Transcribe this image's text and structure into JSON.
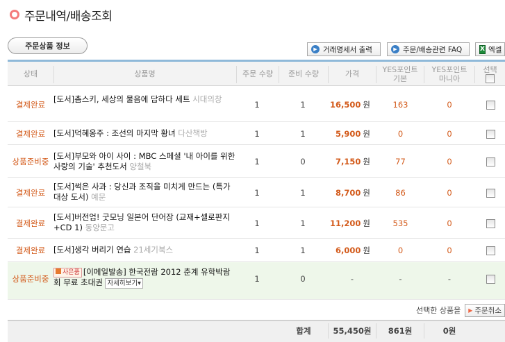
{
  "page": {
    "title": "주문내역/배송조회"
  },
  "tabs": {
    "order_info": "주문상품 정보"
  },
  "toolbar": {
    "receipt": "거래명세서 출력",
    "faq": "주문/배송관련 FAQ",
    "excel": "엑셀",
    "excel_icon": "X"
  },
  "columns": {
    "status": "상태",
    "name": "상품명",
    "qty": "주문 수량",
    "ready": "준비 수량",
    "price": "가격",
    "point_basic_1": "YES포인트",
    "point_basic_2": "기본",
    "point_mania_1": "YES포인트",
    "point_mania_2": "마니아",
    "select": "선택"
  },
  "rows": [
    {
      "status": "결제완료",
      "title": "[도서]촘스키, 세상의 물음에 답하다 세트",
      "publisher": "시대의창",
      "qty": "1",
      "ready": "1",
      "price": "16,500",
      "won": "원",
      "basic": "163",
      "mania": "0"
    },
    {
      "status": "결제완료",
      "title": "[도서]덕혜옹주 : 조선의 마지막 황녀",
      "publisher": "다산책방",
      "qty": "1",
      "ready": "1",
      "price": "5,900",
      "won": "원",
      "basic": "0",
      "mania": "0"
    },
    {
      "status": "상품준비중",
      "title": "[도서]부모와 아이 사이 : MBC 스페셜 '내 아이를 위한 사랑의 기술' 추천도서",
      "publisher": "양철북",
      "qty": "1",
      "ready": "0",
      "price": "7,150",
      "won": "원",
      "basic": "77",
      "mania": "0"
    },
    {
      "status": "결제완료",
      "title": "[도서]썩은 사과 : 당신과 조직을 미치게 만드는 (특가 대상 도서)",
      "publisher": "예문",
      "qty": "1",
      "ready": "1",
      "price": "8,700",
      "won": "원",
      "basic": "86",
      "mania": "0"
    },
    {
      "status": "결제완료",
      "title": "[도서]버전업! 굿모닝 일본어 단어장 (교재+셀로판지+CD 1)",
      "publisher": "동양문고",
      "qty": "1",
      "ready": "1",
      "price": "11,200",
      "won": "원",
      "basic": "535",
      "mania": "0"
    },
    {
      "status": "결제완료",
      "title": "[도서]생각 버리기 연습",
      "publisher": "21세기북스",
      "qty": "1",
      "ready": "1",
      "price": "6,000",
      "won": "원",
      "basic": "0",
      "mania": "0"
    }
  ],
  "gift_row": {
    "status": "상품준비중",
    "tag": "사은품",
    "title": "[이메일발송] 한국전람 2012 춘계 유학박람회 무료 초대권",
    "detail": "자세히보기",
    "qty": "1",
    "ready": "0",
    "price": "-",
    "basic": "-",
    "mania": "-"
  },
  "selection": {
    "label": "선택한 상품을",
    "cancel": "주문취소"
  },
  "summary": {
    "label": "합계",
    "price": "55,450원",
    "basic": "861원",
    "mania": "0원"
  },
  "colors": {
    "accent": "#d35a1a",
    "header_line": "#8fb9d9",
    "gift_row_bg": "#eef7ea"
  }
}
